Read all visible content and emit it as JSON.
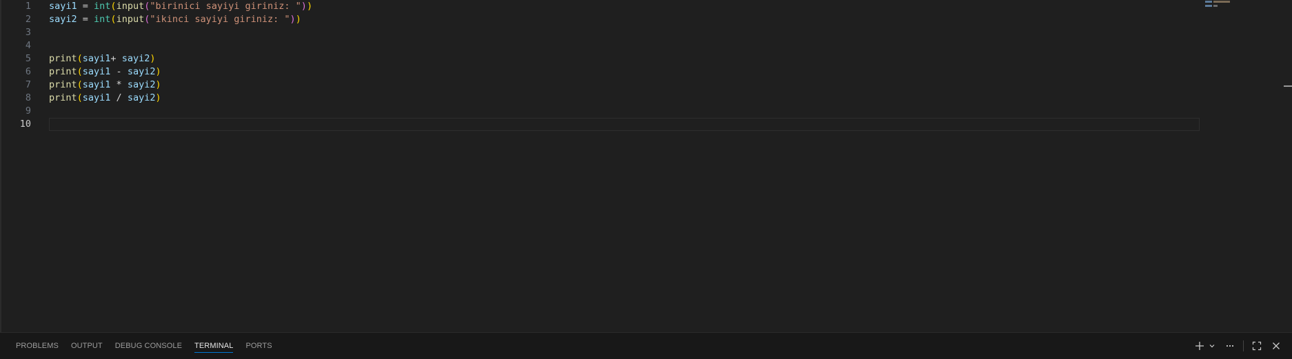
{
  "editor": {
    "lines": [
      {
        "num": "1",
        "tokens": [
          {
            "t": "sayi1",
            "c": "var"
          },
          {
            "t": " = ",
            "c": "op"
          },
          {
            "t": "int",
            "c": "builtin"
          },
          {
            "t": "(",
            "c": "p1"
          },
          {
            "t": "input",
            "c": "fn"
          },
          {
            "t": "(",
            "c": "p2"
          },
          {
            "t": "\"birinici sayiyi giriniz: \"",
            "c": "str"
          },
          {
            "t": ")",
            "c": "p2"
          },
          {
            "t": ")",
            "c": "p1"
          }
        ]
      },
      {
        "num": "2",
        "tokens": [
          {
            "t": "sayi2",
            "c": "var"
          },
          {
            "t": " = ",
            "c": "op"
          },
          {
            "t": "int",
            "c": "builtin"
          },
          {
            "t": "(",
            "c": "p1"
          },
          {
            "t": "input",
            "c": "fn"
          },
          {
            "t": "(",
            "c": "p2"
          },
          {
            "t": "\"ikinci sayiyi giriniz: \"",
            "c": "str"
          },
          {
            "t": ")",
            "c": "p2"
          },
          {
            "t": ")",
            "c": "p1"
          }
        ]
      },
      {
        "num": "3",
        "tokens": []
      },
      {
        "num": "4",
        "tokens": []
      },
      {
        "num": "5",
        "tokens": [
          {
            "t": "print",
            "c": "fn"
          },
          {
            "t": "(",
            "c": "p1"
          },
          {
            "t": "sayi1",
            "c": "var"
          },
          {
            "t": "+ ",
            "c": "op"
          },
          {
            "t": "sayi2",
            "c": "var"
          },
          {
            "t": ")",
            "c": "p1"
          }
        ]
      },
      {
        "num": "6",
        "tokens": [
          {
            "t": "print",
            "c": "fn"
          },
          {
            "t": "(",
            "c": "p1"
          },
          {
            "t": "sayi1",
            "c": "var"
          },
          {
            "t": " - ",
            "c": "op"
          },
          {
            "t": "sayi2",
            "c": "var"
          },
          {
            "t": ")",
            "c": "p1"
          }
        ]
      },
      {
        "num": "7",
        "tokens": [
          {
            "t": "print",
            "c": "fn"
          },
          {
            "t": "(",
            "c": "p1"
          },
          {
            "t": "sayi1",
            "c": "var"
          },
          {
            "t": " * ",
            "c": "op"
          },
          {
            "t": "sayi2",
            "c": "var"
          },
          {
            "t": ")",
            "c": "p1"
          }
        ]
      },
      {
        "num": "8",
        "tokens": [
          {
            "t": "print",
            "c": "fn"
          },
          {
            "t": "(",
            "c": "p1"
          },
          {
            "t": "sayi1",
            "c": "var"
          },
          {
            "t": " / ",
            "c": "op"
          },
          {
            "t": "sayi2",
            "c": "var"
          },
          {
            "t": ")",
            "c": "p1"
          }
        ]
      },
      {
        "num": "9",
        "tokens": []
      },
      {
        "num": "10",
        "tokens": [],
        "current": true
      }
    ]
  },
  "panel": {
    "tabs": [
      {
        "label": "PROBLEMS"
      },
      {
        "label": "OUTPUT"
      },
      {
        "label": "DEBUG CONSOLE"
      },
      {
        "label": "TERMINAL",
        "active": true
      },
      {
        "label": "PORTS"
      }
    ],
    "actions": {
      "new_terminal_icon": "plus-icon",
      "dropdown_icon": "chevron-down-icon",
      "more_icon": "ellipsis-icon",
      "maximize_icon": "maximize-icon",
      "close_icon": "close-icon"
    }
  },
  "theme": {
    "editor_bg": "#1f1f1f",
    "panel_bg": "#181818",
    "accent": "#0078d4"
  }
}
